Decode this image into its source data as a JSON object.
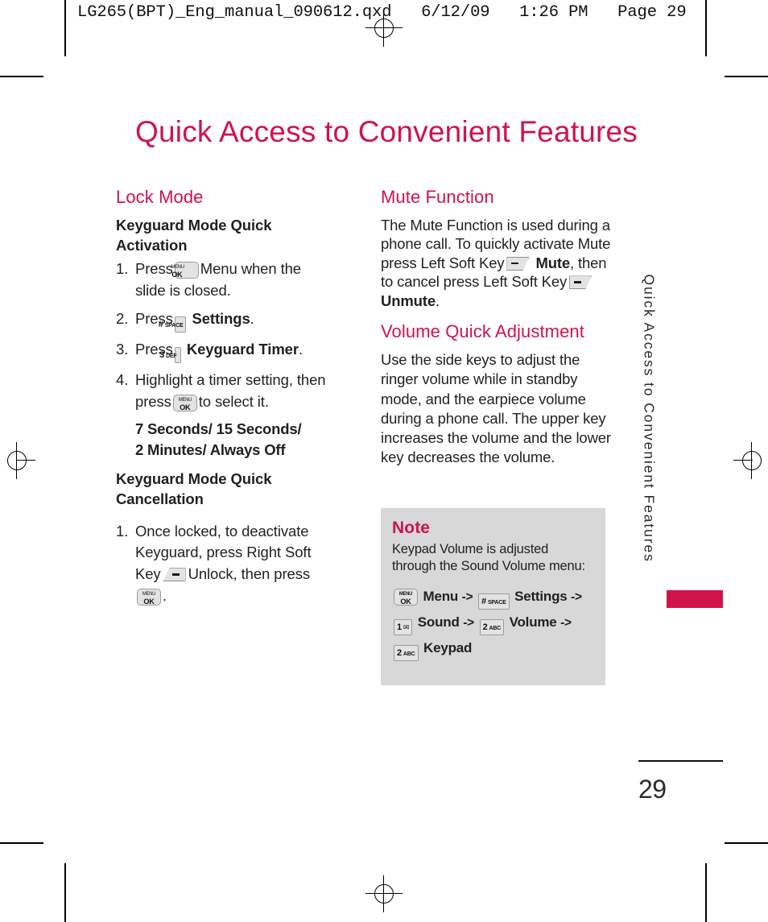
{
  "header_slug": "LG265(BPT)_Eng_manual_090612.qxd   6/12/09   1:26 PM   Page 29",
  "chapter_title": "Quick Access to Convenient Features",
  "side_tab": "Quick Access to Convenient Features",
  "page_number": "29",
  "colors": {
    "accent": "#d1134a",
    "text": "#231f20",
    "note_background": "#d8d8d8",
    "key_fill": "#e3e3e3"
  },
  "left_column": {
    "section_title": "Lock Mode",
    "activation": {
      "heading_line1": "Keyguard Mode Quick",
      "heading_line2": "Activation",
      "steps": [
        {
          "number": "1.",
          "before": "Press",
          "key": "MENU/OK",
          "after": "Menu when the",
          "continuation": "slide is closed."
        },
        {
          "number": "2.",
          "before": "Press",
          "key": "# SPACE",
          "after_bold": "Settings",
          "after": "."
        },
        {
          "number": "3.",
          "before": "Press",
          "key": "3 DEF",
          "after_bold": "Keyguard Timer",
          "after": "."
        },
        {
          "number": "4.",
          "before": "Highlight a timer setting, then",
          "continuation_before": "press",
          "key": "MENU/OK",
          "continuation_after": "to select it."
        }
      ],
      "timer_options_line1": "7 Seconds/ 15 Seconds/",
      "timer_options_line2": "2 Minutes/ Always Off"
    },
    "cancellation": {
      "heading_line1": "Keyguard Mode Quick",
      "heading_line2": "Cancellation",
      "step": {
        "number": "1.",
        "line1": "Once locked, to deactivate",
        "line2": "Keyguard, press Right Soft",
        "line3_before": "Key",
        "line3_key": "right-soft-key",
        "line3_after": "Unlock, then press",
        "line4_key": "MENU/OK",
        "line4_after": "."
      }
    }
  },
  "right_column": {
    "mute": {
      "section_title": "Mute Function",
      "text_1": "The Mute Function is used during a phone call. To quickly activate Mute press Left Soft Key",
      "key_1": "left-soft-key",
      "bold_1": "Mute",
      "text_2": ", then to cancel press Left Soft Key",
      "key_2": "left-soft-key",
      "bold_2": "Unmute",
      "text_3": "."
    },
    "volume": {
      "section_title": "Volume Quick Adjustment",
      "text": "Use the side keys to adjust the ringer volume while in standby mode, and the earpiece volume during a phone call. The upper key increases the volume and the lower key decreases the volume."
    },
    "note": {
      "title": "Note",
      "text": "Keypad Volume is adjusted through the Sound Volume menu:",
      "path": [
        {
          "key": "MENU/OK",
          "label": "Menu",
          "arrow": "->"
        },
        {
          "key": "# SPACE",
          "label": "Settings",
          "arrow": "->"
        },
        {
          "key": "1 ENVELOPE",
          "label": "Sound",
          "arrow": "->"
        },
        {
          "key": "2 ABC",
          "label": "Volume",
          "arrow": "->"
        },
        {
          "key": "2 ABC",
          "label": "Keypad",
          "arrow": ""
        }
      ]
    }
  },
  "keys": {
    "menu_ok": {
      "line1": "MENU",
      "line2": "OK"
    },
    "hash_space": {
      "digit": "#",
      "sup": "SPACE"
    },
    "three_def": {
      "digit": "3",
      "sup": "DEF"
    },
    "one_env": {
      "digit": "1",
      "sup": "✉"
    },
    "two_abc": {
      "digit": "2",
      "sup": "ABC"
    }
  }
}
